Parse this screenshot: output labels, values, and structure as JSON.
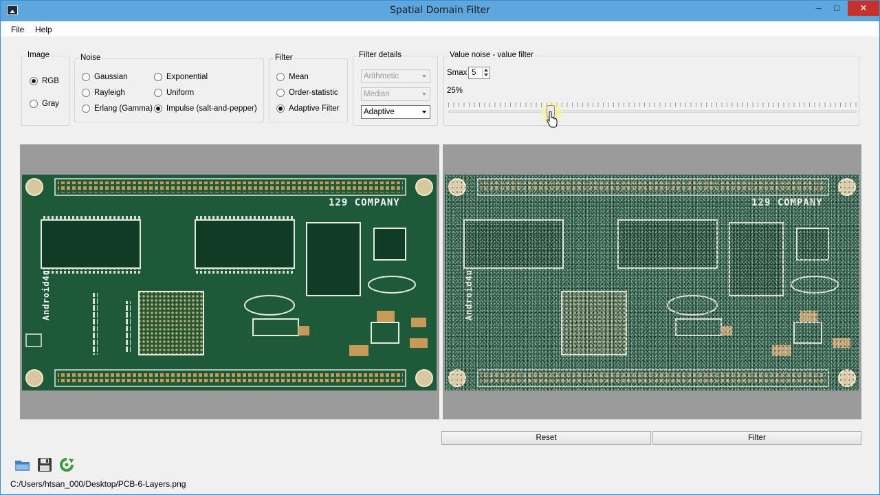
{
  "window": {
    "title": "Spatial Domain Filter",
    "minimize": "–",
    "maximize": "□",
    "close": "✕"
  },
  "menu": {
    "items": [
      "File",
      "Help"
    ]
  },
  "image_group": {
    "title": "Image",
    "options": [
      "RGB",
      "Gray"
    ],
    "selected": "RGB"
  },
  "noise_group": {
    "title": "Noise",
    "options": [
      "Gaussian",
      "Exponential",
      "Rayleigh",
      "Uniform",
      "Erlang (Gamma)",
      "Impulse (salt-and-pepper)"
    ],
    "selected": "Impulse (salt-and-pepper)"
  },
  "filter_group": {
    "title": "Filter",
    "options": [
      "Mean",
      "Order-statistic",
      "Adaptive Filter"
    ],
    "selected": "Adaptive Filter"
  },
  "filter_details": {
    "title": "Filter details",
    "mean_combo": "Arithmetic",
    "order_combo": "Median",
    "adaptive_combo": "Adaptive"
  },
  "value_group": {
    "title": "Value noise - value filter",
    "smax_label": "Smax",
    "smax_value": "5",
    "noise_percent": "25%",
    "slider_value": 0.25
  },
  "pcb": {
    "company": "129 COMPANY",
    "side_text": "Android4u"
  },
  "buttons": {
    "reset": "Reset",
    "filter": "Filter"
  },
  "toolbar": {
    "open": "folder-open-icon",
    "save": "save-icon",
    "refresh": "refresh-icon"
  },
  "status": {
    "path": "C:/Users/htsan_000/Desktop/PCB-6-Layers.png"
  }
}
